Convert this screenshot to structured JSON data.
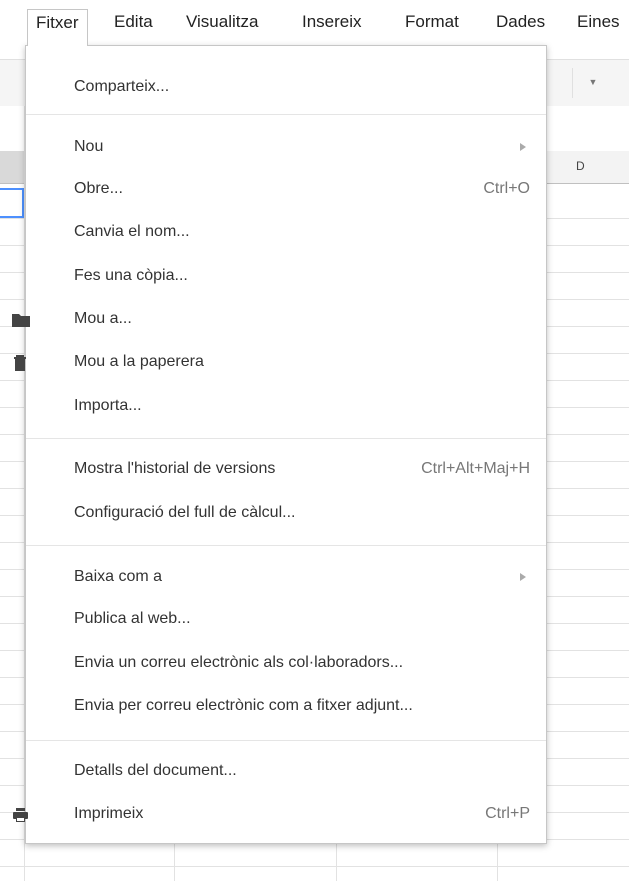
{
  "menubar": {
    "items": [
      {
        "label": "Fitxer"
      },
      {
        "label": "Edita"
      },
      {
        "label": "Visualitza"
      },
      {
        "label": "Insereix"
      },
      {
        "label": "Format"
      },
      {
        "label": "Dades"
      },
      {
        "label": "Eines"
      }
    ]
  },
  "sheet": {
    "column_d_label": "D"
  },
  "file_menu": {
    "items": [
      {
        "label": "Comparteix...",
        "shortcut": "",
        "submenu": false,
        "icon": ""
      },
      {
        "label": "Nou",
        "shortcut": "",
        "submenu": true,
        "icon": ""
      },
      {
        "label": "Obre...",
        "shortcut": "Ctrl+O",
        "submenu": false,
        "icon": ""
      },
      {
        "label": "Canvia el nom...",
        "shortcut": "",
        "submenu": false,
        "icon": ""
      },
      {
        "label": "Fes una còpia...",
        "shortcut": "",
        "submenu": false,
        "icon": ""
      },
      {
        "label": "Mou a...",
        "shortcut": "",
        "submenu": false,
        "icon": "folder-icon"
      },
      {
        "label": "Mou a la paperera",
        "shortcut": "",
        "submenu": false,
        "icon": "trash-icon"
      },
      {
        "label": "Importa...",
        "shortcut": "",
        "submenu": false,
        "icon": ""
      },
      {
        "label": "Mostra l'historial de versions",
        "shortcut": "Ctrl+Alt+Maj+H",
        "submenu": false,
        "icon": ""
      },
      {
        "label": "Configuració del full de càlcul...",
        "shortcut": "",
        "submenu": false,
        "icon": ""
      },
      {
        "label": "Baixa com a",
        "shortcut": "",
        "submenu": true,
        "icon": ""
      },
      {
        "label": "Publica al web...",
        "shortcut": "",
        "submenu": false,
        "icon": ""
      },
      {
        "label": "Envia un correu electrònic als col·laboradors...",
        "shortcut": "",
        "submenu": false,
        "icon": ""
      },
      {
        "label": "Envia per correu electrònic com a fitxer adjunt...",
        "shortcut": "",
        "submenu": false,
        "icon": ""
      },
      {
        "label": "Detalls del document...",
        "shortcut": "",
        "submenu": false,
        "icon": ""
      },
      {
        "label": "Imprimeix",
        "shortcut": "Ctrl+P",
        "submenu": false,
        "icon": "printer-icon"
      }
    ]
  },
  "colors": {
    "selection_border": "#4d90fe",
    "menu_border": "#c6c6c6",
    "text": "#333333",
    "shortcut_text": "#777777"
  }
}
